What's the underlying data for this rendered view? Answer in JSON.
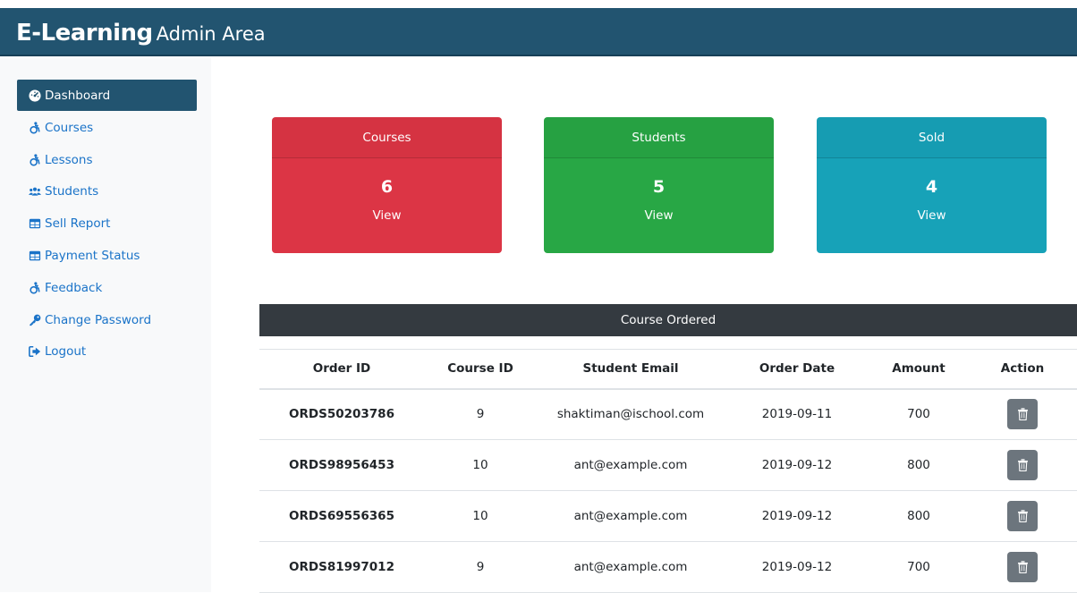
{
  "header": {
    "brand": "E-Learning",
    "subtitle": "Admin Area"
  },
  "sidebar": {
    "items": [
      {
        "label": "Dashboard",
        "icon": "tachometer-icon",
        "active": true
      },
      {
        "label": "Courses",
        "icon": "accessible-icon"
      },
      {
        "label": "Lessons",
        "icon": "accessible-icon"
      },
      {
        "label": "Students",
        "icon": "users-icon"
      },
      {
        "label": "Sell Report",
        "icon": "table-icon"
      },
      {
        "label": "Payment Status",
        "icon": "table-icon"
      },
      {
        "label": "Feedback",
        "icon": "accessible-icon"
      },
      {
        "label": "Change Password",
        "icon": "key-icon"
      },
      {
        "label": "Logout",
        "icon": "sign-out-icon"
      }
    ]
  },
  "cards": [
    {
      "title": "Courses",
      "value": "6",
      "link": "View",
      "color": "#dc3545"
    },
    {
      "title": "Students",
      "value": "5",
      "link": "View",
      "color": "#28a745"
    },
    {
      "title": "Sold",
      "value": "4",
      "link": "View",
      "color": "#17a2b8"
    }
  ],
  "orders": {
    "title": "Course Ordered",
    "columns": [
      "Order ID",
      "Course ID",
      "Student Email",
      "Order Date",
      "Amount",
      "Action"
    ],
    "rows": [
      {
        "order_id": "ORDS50203786",
        "course_id": "9",
        "email": "shaktiman@ischool.com",
        "date": "2019-09-11",
        "amount": "700"
      },
      {
        "order_id": "ORDS98956453",
        "course_id": "10",
        "email": "ant@example.com",
        "date": "2019-09-12",
        "amount": "800"
      },
      {
        "order_id": "ORDS69556365",
        "course_id": "10",
        "email": "ant@example.com",
        "date": "2019-09-12",
        "amount": "800"
      },
      {
        "order_id": "ORDS81997012",
        "course_id": "9",
        "email": "ant@example.com",
        "date": "2019-09-12",
        "amount": "700"
      }
    ],
    "action_icon": "trash-icon"
  }
}
